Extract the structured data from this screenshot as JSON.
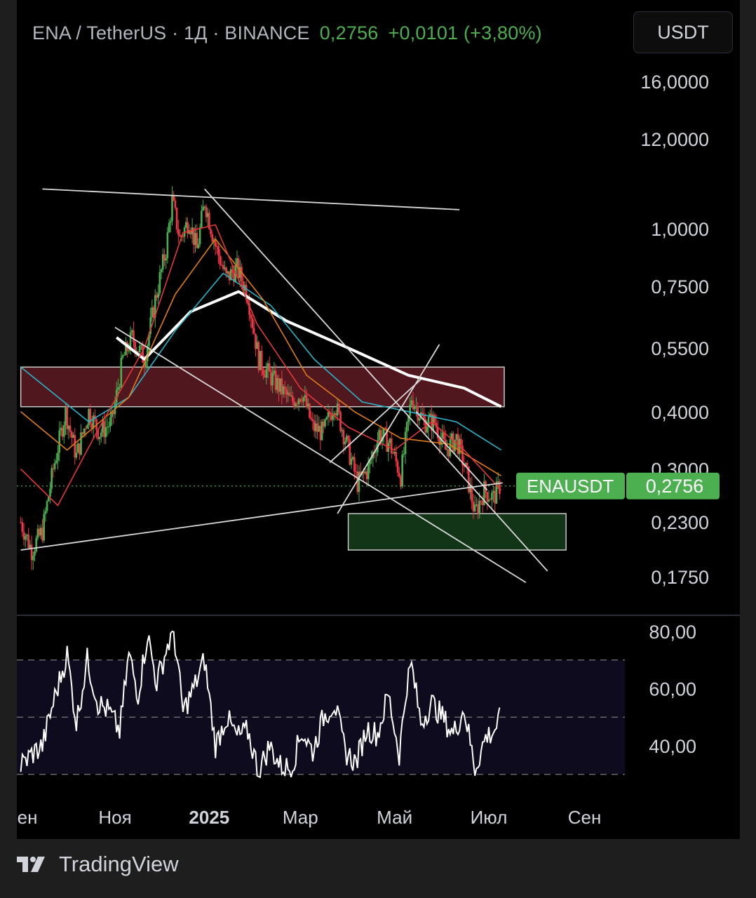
{
  "header": {
    "symbol": "ENA / TetherUS · 1Д · BINANCE",
    "price": "0,2756",
    "change": "+0,0101 (+3,80%)",
    "currency_button": "USDT"
  },
  "footer": {
    "brand": "TradingView"
  },
  "colors": {
    "up": "#4caf50",
    "down": "#f23645",
    "ema_short": "#e53935",
    "ema_mid": "#e07b1a",
    "ema_long": "#2bb5c8",
    "ma_white": "#ffffff",
    "resistance_zone": "#5a1a22",
    "support_zone": "#143a1a"
  },
  "chart_data": {
    "type": "candlestick",
    "symbol": "ENAUSDT",
    "exchange": "BINANCE",
    "interval": "1Д",
    "last_price": 0.2756,
    "price_label": "ENAUSDT",
    "price_label_value": "0,2756",
    "price_axis_ticks": [
      "16,0000",
      "12,0000",
      "1,0000",
      "0,7500",
      "0,5500",
      "0,4000",
      "0,3000",
      "0,2300",
      "0,1750"
    ],
    "price_axis_tick_values": [
      16,
      12,
      1.0,
      0.75,
      0.55,
      0.4,
      0.3,
      0.23,
      0.175
    ],
    "time_axis_labels": [
      "Сен",
      "Ноя",
      "2025",
      "Мар",
      "Май",
      "Июл",
      "Сен"
    ],
    "time_axis_dates": [
      "2024-09-01",
      "2024-11-01",
      "2025-01-01",
      "2025-03-01",
      "2025-05-01",
      "2025-07-01",
      "2025-09-01"
    ],
    "price_path": [
      [
        "2024-09-01",
        0.23
      ],
      [
        "2024-09-08",
        0.2
      ],
      [
        "2024-09-15",
        0.22
      ],
      [
        "2024-09-22",
        0.3
      ],
      [
        "2024-09-30",
        0.4
      ],
      [
        "2024-10-07",
        0.32
      ],
      [
        "2024-10-15",
        0.4
      ],
      [
        "2024-10-22",
        0.36
      ],
      [
        "2024-10-30",
        0.38
      ],
      [
        "2024-11-06",
        0.52
      ],
      [
        "2024-11-12",
        0.58
      ],
      [
        "2024-11-20",
        0.52
      ],
      [
        "2024-11-27",
        0.7
      ],
      [
        "2024-12-04",
        0.9
      ],
      [
        "2024-12-08",
        1.15
      ],
      [
        "2024-12-13",
        0.95
      ],
      [
        "2024-12-19",
        1.05
      ],
      [
        "2024-12-24",
        0.9
      ],
      [
        "2024-12-29",
        1.15
      ],
      [
        "2025-01-05",
        0.92
      ],
      [
        "2025-01-12",
        0.78
      ],
      [
        "2025-01-19",
        0.82
      ],
      [
        "2025-01-26",
        0.72
      ],
      [
        "2025-02-02",
        0.52
      ],
      [
        "2025-02-09",
        0.48
      ],
      [
        "2025-02-16",
        0.45
      ],
      [
        "2025-02-23",
        0.42
      ],
      [
        "2025-03-02",
        0.44
      ],
      [
        "2025-03-09",
        0.37
      ],
      [
        "2025-03-16",
        0.36
      ],
      [
        "2025-03-23",
        0.42
      ],
      [
        "2025-03-30",
        0.35
      ],
      [
        "2025-04-07",
        0.28
      ],
      [
        "2025-04-14",
        0.3
      ],
      [
        "2025-04-21",
        0.36
      ],
      [
        "2025-04-28",
        0.34
      ],
      [
        "2025-05-05",
        0.29
      ],
      [
        "2025-05-12",
        0.43
      ],
      [
        "2025-05-20",
        0.38
      ],
      [
        "2025-05-27",
        0.38
      ],
      [
        "2025-06-03",
        0.33
      ],
      [
        "2025-06-10",
        0.35
      ],
      [
        "2025-06-17",
        0.29
      ],
      [
        "2025-06-22",
        0.24
      ],
      [
        "2025-06-28",
        0.27
      ],
      [
        "2025-07-04",
        0.26
      ],
      [
        "2025-07-08",
        0.2756
      ]
    ],
    "horizontal_zones": [
      {
        "name": "resistance",
        "from": "2024-09-01",
        "to": "2025-07-11",
        "low": 0.41,
        "high": 0.5
      },
      {
        "name": "support",
        "from": "2025-04-01",
        "to": "2025-08-20",
        "low": 0.2,
        "high": 0.24
      }
    ],
    "moving_averages": [
      {
        "color": "#ffffff",
        "points": [
          [
            "2024-11-02",
            0.58
          ],
          [
            "2024-11-20",
            0.52
          ],
          [
            "2024-12-20",
            0.66
          ],
          [
            "2025-01-20",
            0.73
          ],
          [
            "2025-02-20",
            0.63
          ],
          [
            "2025-04-01",
            0.55
          ],
          [
            "2025-05-10",
            0.48
          ],
          [
            "2025-06-15",
            0.45
          ],
          [
            "2025-07-09",
            0.41
          ]
        ]
      },
      {
        "color": "#2bb5c8",
        "points": [
          [
            "2024-09-01",
            0.5
          ],
          [
            "2024-10-15",
            0.38
          ],
          [
            "2024-11-10",
            0.43
          ],
          [
            "2024-12-10",
            0.6
          ],
          [
            "2025-01-10",
            0.8
          ],
          [
            "2025-02-10",
            0.68
          ],
          [
            "2025-03-10",
            0.52
          ],
          [
            "2025-04-10",
            0.42
          ],
          [
            "2025-05-10",
            0.4
          ],
          [
            "2025-06-10",
            0.38
          ],
          [
            "2025-07-09",
            0.33
          ]
        ]
      },
      {
        "color": "#e07b1a",
        "points": [
          [
            "2024-09-01",
            0.4
          ],
          [
            "2024-10-01",
            0.33
          ],
          [
            "2024-11-10",
            0.43
          ],
          [
            "2024-12-10",
            0.72
          ],
          [
            "2025-01-05",
            0.95
          ],
          [
            "2025-02-05",
            0.7
          ],
          [
            "2025-03-05",
            0.48
          ],
          [
            "2025-04-05",
            0.4
          ],
          [
            "2025-05-05",
            0.35
          ],
          [
            "2025-06-05",
            0.34
          ],
          [
            "2025-07-09",
            0.29
          ]
        ]
      },
      {
        "color": "#e53935",
        "points": [
          [
            "2024-09-01",
            0.3
          ],
          [
            "2024-09-25",
            0.25
          ],
          [
            "2024-10-20",
            0.36
          ],
          [
            "2024-11-20",
            0.55
          ],
          [
            "2024-12-15",
            0.98
          ],
          [
            "2025-01-05",
            1.02
          ],
          [
            "2025-02-01",
            0.62
          ],
          [
            "2025-03-01",
            0.45
          ],
          [
            "2025-04-01",
            0.37
          ],
          [
            "2025-05-01",
            0.33
          ],
          [
            "2025-05-25",
            0.38
          ],
          [
            "2025-06-15",
            0.33
          ],
          [
            "2025-07-09",
            0.27
          ]
        ]
      }
    ],
    "trendlines": [
      {
        "from": [
          "2024-09-15",
          1.22
        ],
        "to": [
          "2025-06-12",
          1.1
        ]
      },
      {
        "from": [
          "2024-12-29",
          1.22
        ],
        "to": [
          "2025-08-08",
          0.18
        ]
      },
      {
        "from": [
          "2024-11-01",
          0.61
        ],
        "to": [
          "2025-07-25",
          0.17
        ]
      },
      {
        "from": [
          "2024-09-01",
          0.2
        ],
        "to": [
          "2025-07-10",
          0.28
        ]
      },
      {
        "from": [
          "2025-03-25",
          0.24
        ],
        "to": [
          "2025-05-30",
          0.56
        ]
      },
      {
        "from": [
          "2025-03-20",
          0.31
        ],
        "to": [
          "2025-05-18",
          0.47
        ]
      },
      {
        "from": [
          "2025-05-15",
          0.4
        ],
        "to": [
          "2025-06-30",
          0.27
        ]
      }
    ],
    "rsi": {
      "ticks": [
        "80,00",
        "60,00",
        "40,00"
      ],
      "tick_values": [
        80,
        60,
        40
      ],
      "band": [
        30,
        70
      ],
      "middle": 50,
      "points": [
        [
          "2024-09-01",
          33
        ],
        [
          "2024-09-08",
          37
        ],
        [
          "2024-09-15",
          40
        ],
        [
          "2024-09-22",
          55
        ],
        [
          "2024-10-01",
          72
        ],
        [
          "2024-10-07",
          48
        ],
        [
          "2024-10-14",
          70
        ],
        [
          "2024-10-21",
          55
        ],
        [
          "2024-10-28",
          52
        ],
        [
          "2024-11-04",
          45
        ],
        [
          "2024-11-10",
          72
        ],
        [
          "2024-11-16",
          58
        ],
        [
          "2024-11-22",
          79
        ],
        [
          "2024-11-28",
          62
        ],
        [
          "2024-12-05",
          75
        ],
        [
          "2024-12-09",
          80
        ],
        [
          "2024-12-15",
          52
        ],
        [
          "2024-12-22",
          60
        ],
        [
          "2024-12-29",
          70
        ],
        [
          "2025-01-05",
          40
        ],
        [
          "2025-01-12",
          50
        ],
        [
          "2025-01-19",
          43
        ],
        [
          "2025-01-26",
          45
        ],
        [
          "2025-02-02",
          31
        ],
        [
          "2025-02-09",
          40
        ],
        [
          "2025-02-16",
          33
        ],
        [
          "2025-02-23",
          32
        ],
        [
          "2025-03-02",
          45
        ],
        [
          "2025-03-09",
          38
        ],
        [
          "2025-03-16",
          50
        ],
        [
          "2025-03-23",
          55
        ],
        [
          "2025-03-30",
          38
        ],
        [
          "2025-04-06",
          34
        ],
        [
          "2025-04-13",
          46
        ],
        [
          "2025-04-20",
          44
        ],
        [
          "2025-04-27",
          58
        ],
        [
          "2025-05-04",
          37
        ],
        [
          "2025-05-09",
          62
        ],
        [
          "2025-05-12",
          68
        ],
        [
          "2025-05-18",
          48
        ],
        [
          "2025-05-25",
          55
        ],
        [
          "2025-06-01",
          50
        ],
        [
          "2025-06-08",
          44
        ],
        [
          "2025-06-15",
          53
        ],
        [
          "2025-06-22",
          32
        ],
        [
          "2025-06-29",
          43
        ],
        [
          "2025-07-04",
          45
        ],
        [
          "2025-07-09",
          50
        ]
      ]
    }
  }
}
